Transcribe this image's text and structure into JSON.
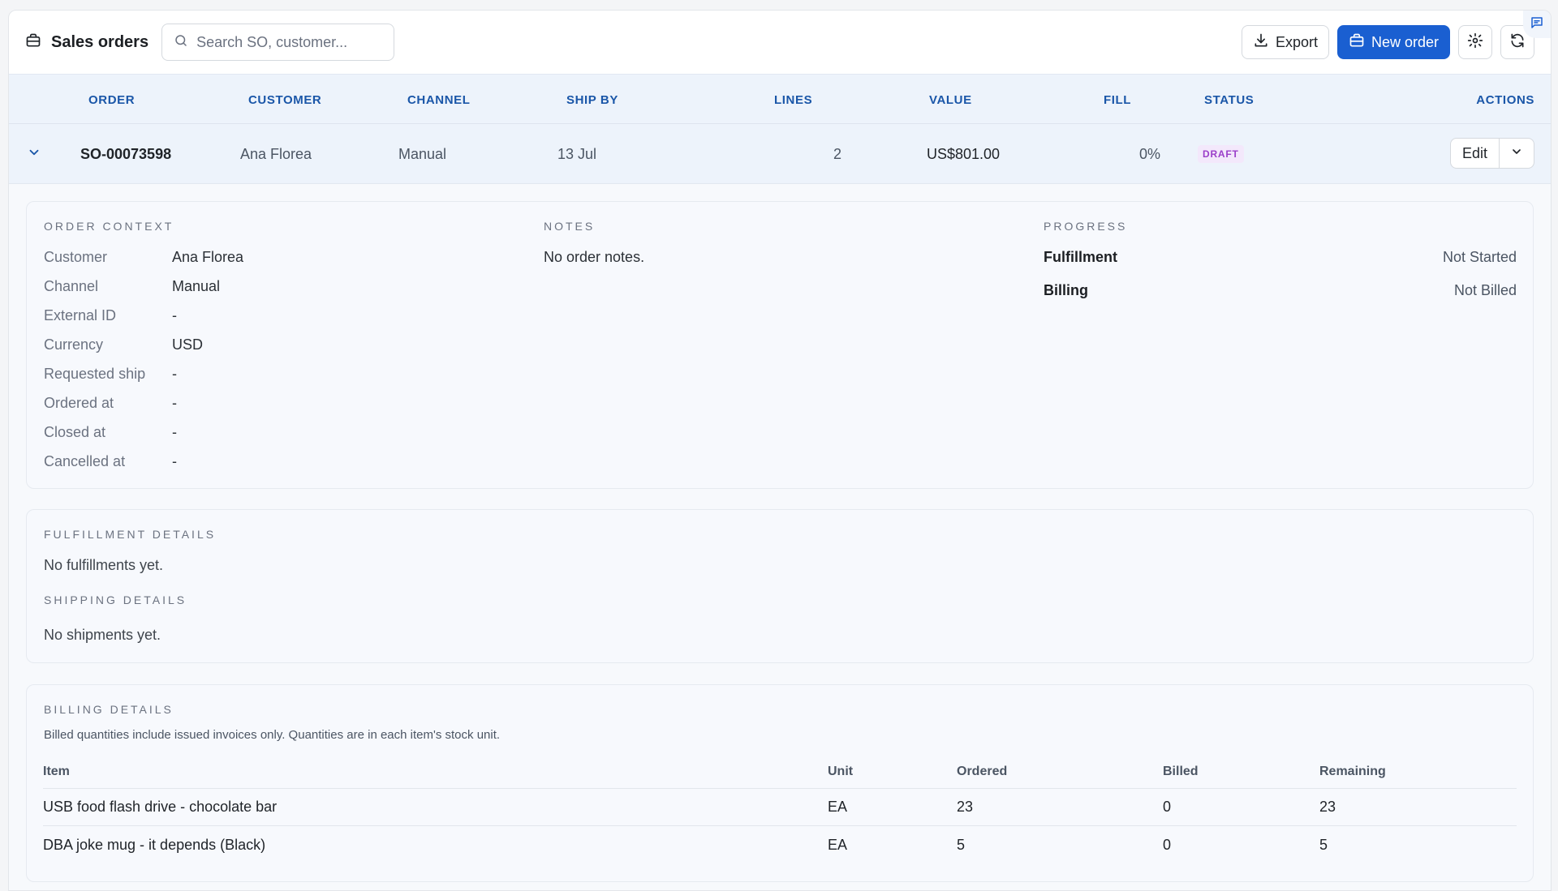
{
  "app": {
    "title": "Sales orders",
    "search_placeholder": "Search SO, customer...",
    "export_label": "Export",
    "new_order_label": "New order"
  },
  "table": {
    "columns": [
      "ORDER",
      "CUSTOMER",
      "CHANNEL",
      "SHIP BY",
      "LINES",
      "VALUE",
      "FILL",
      "STATUS",
      "ACTIONS"
    ],
    "row": {
      "order": "SO-00073598",
      "customer": "Ana Florea",
      "channel": "Manual",
      "ship_by": "13 Jul",
      "lines": "2",
      "value": "US$801.00",
      "fill": "0%",
      "status": "DRAFT",
      "edit_label": "Edit"
    }
  },
  "order_context": {
    "label": "ORDER CONTEXT",
    "fields": [
      {
        "key": "Customer",
        "value": "Ana Florea"
      },
      {
        "key": "Channel",
        "value": "Manual"
      },
      {
        "key": "External ID",
        "value": "-"
      },
      {
        "key": "Currency",
        "value": "USD"
      },
      {
        "key": "Requested ship",
        "value": "-"
      },
      {
        "key": "Ordered at",
        "value": "-"
      },
      {
        "key": "Closed at",
        "value": "-"
      },
      {
        "key": "Cancelled at",
        "value": "-"
      }
    ]
  },
  "notes": {
    "label": "NOTES",
    "text": "No order notes."
  },
  "progress": {
    "label": "PROGRESS",
    "items": [
      {
        "key": "Fulfillment",
        "value": "Not Started"
      },
      {
        "key": "Billing",
        "value": "Not Billed"
      }
    ]
  },
  "fulfillment": {
    "label": "FULFILLMENT DETAILS",
    "text": "No fulfillments yet."
  },
  "shipping": {
    "label": "SHIPPING DETAILS",
    "text": "No shipments yet."
  },
  "billing": {
    "label": "BILLING DETAILS",
    "note": "Billed quantities include issued invoices only. Quantities are in each item's stock unit.",
    "columns": [
      "Item",
      "Unit",
      "Ordered",
      "Billed",
      "Remaining"
    ],
    "rows": [
      {
        "item": "USB food flash drive - chocolate bar",
        "unit": "EA",
        "ordered": "23",
        "billed": "0",
        "remaining": "23"
      },
      {
        "item": "DBA joke mug - it depends (Black)",
        "unit": "EA",
        "ordered": "5",
        "billed": "0",
        "remaining": "5"
      }
    ]
  },
  "colors": {
    "primary": "#1a5fd1",
    "header_text": "#1a56a8",
    "draft_badge": "#9b3fc9"
  }
}
